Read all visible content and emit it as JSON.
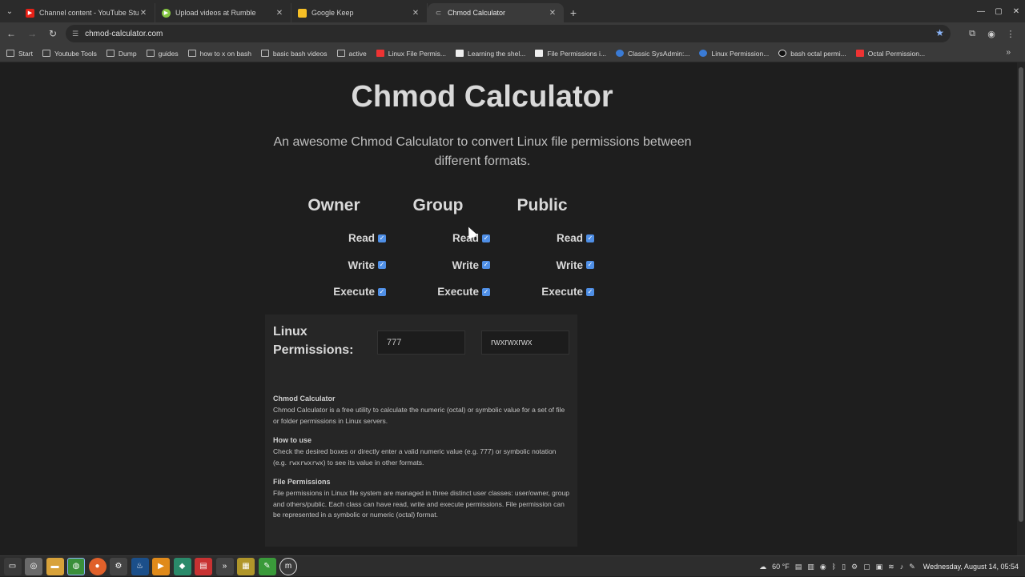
{
  "tabs": [
    {
      "title": "Channel content - YouTube Studio",
      "icon": "youtube-icon",
      "color": "#e62117",
      "active": false
    },
    {
      "title": "Upload videos at Rumble",
      "icon": "rumble-icon",
      "color": "#85c742",
      "active": false
    },
    {
      "title": "Google Keep",
      "icon": "keep-icon",
      "color": "#f6bf26",
      "active": false
    },
    {
      "title": "Chmod Calculator",
      "icon": "chmod-icon",
      "color": "#666666",
      "active": true
    }
  ],
  "browser": {
    "url": "chmod-calculator.com"
  },
  "bookmarks": [
    {
      "label": "Start",
      "icon": "folder"
    },
    {
      "label": "Youtube Tools",
      "icon": "folder"
    },
    {
      "label": "Dump",
      "icon": "folder"
    },
    {
      "label": "guides",
      "icon": "folder"
    },
    {
      "label": "how to x on bash",
      "icon": "folder"
    },
    {
      "label": "basic bash videos",
      "icon": "folder"
    },
    {
      "label": "active",
      "icon": "folder"
    },
    {
      "label": "Linux File Permis...",
      "icon": "yt"
    },
    {
      "label": "Learning the shel...",
      "icon": "page"
    },
    {
      "label": "File Permissions i...",
      "icon": "page"
    },
    {
      "label": "Classic SysAdmin:...",
      "icon": "blue"
    },
    {
      "label": "Linux Permission...",
      "icon": "blue"
    },
    {
      "label": "bash octal permi...",
      "icon": "dark"
    },
    {
      "label": "Octal Permission...",
      "icon": "yt"
    }
  ],
  "page": {
    "title": "Chmod Calculator",
    "subtitle": "An awesome Chmod Calculator to convert Linux file permissions between different formats.",
    "columns": [
      {
        "heading": "Owner",
        "read": "Read",
        "write": "Write",
        "execute": "Execute"
      },
      {
        "heading": "Group",
        "read": "Read",
        "write": "Write",
        "execute": "Execute"
      },
      {
        "heading": "Public",
        "read": "Read",
        "write": "Write",
        "execute": "Execute"
      }
    ],
    "permissions_label": "Linux Permissions:",
    "octal_value": "777",
    "symbolic_value": "rwxrwxrwx",
    "info": {
      "h1": "Chmod Calculator",
      "p1": "Chmod Calculator is a free utility to calculate the numeric (octal) or symbolic value for a set of file or folder permissions in Linux servers.",
      "h2": "How to use",
      "p2a": "Check the desired boxes or directly enter a valid numeric value (e.g. 777) or symbolic notation (e.g. ",
      "p2code": "rwxrwxrwx",
      "p2b": ") to see its value in other formats.",
      "h3": "File Permissions",
      "p3": "File permissions in Linux file system are managed in three distinct user classes: user/owner, group and others/public. Each class can have read, write and execute permissions. File permission can be represented in a symbolic or numeric (octal) format."
    }
  },
  "taskbar": {
    "temperature": "60 °F",
    "clock": "Wednesday, August 14, 05:54"
  },
  "colors": {
    "checkbox": "#4f8fe6",
    "background": "#1e1e1e"
  }
}
